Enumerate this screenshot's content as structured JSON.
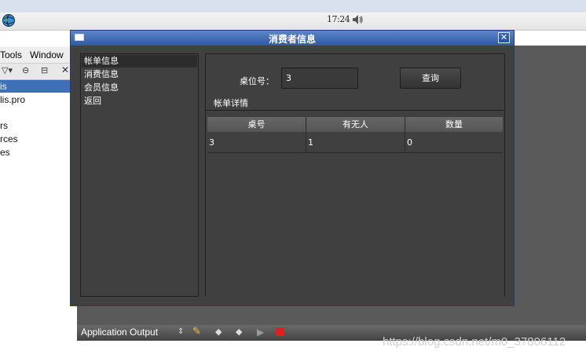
{
  "panel": {
    "clock": "17:24"
  },
  "ide": {
    "menu": [
      "Tools",
      "Window"
    ],
    "tree_items": [
      "is",
      "lis.pro",
      "rs",
      "rces",
      "es"
    ],
    "output_title": "Application Output"
  },
  "watermark": "https://blog.csdn.net/m0_37806112",
  "dialog": {
    "title": "消费者信息",
    "nav_items": [
      "帐单信息",
      "消费信息",
      "会员信息",
      "返回"
    ],
    "table_label": "桌位号：",
    "table_input_value": "3",
    "query_button": "查询",
    "details_label": "帐单详情",
    "columns": [
      "桌号",
      "有无人",
      "数量"
    ],
    "rows": [
      [
        "3",
        "1",
        "0"
      ]
    ]
  },
  "colors": {
    "titlebar": "#2d5aa6",
    "dialog_bg": "#404040",
    "selection": "#3f6fb4"
  }
}
